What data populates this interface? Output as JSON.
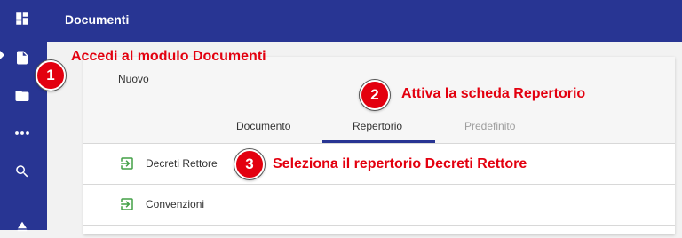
{
  "sidebar": {
    "icons": [
      "dashboard-icon",
      "document-icon",
      "folder-icon",
      "more-horizontal-icon",
      "search-icon",
      "eject-icon"
    ]
  },
  "header": {
    "title": "Documenti"
  },
  "card": {
    "new_label": "Nuovo",
    "tabs": [
      {
        "label": "Documento",
        "state": "normal"
      },
      {
        "label": "Repertorio",
        "state": "active"
      },
      {
        "label": "Predefinito",
        "state": "disabled"
      }
    ],
    "items": [
      {
        "label": "Decreti Rettore",
        "icon": "exit-to-app-icon"
      },
      {
        "label": "Convenzioni",
        "icon": "exit-to-app-icon"
      }
    ]
  },
  "annotations": [
    {
      "number": "1",
      "text": "Accedi al modulo Documenti"
    },
    {
      "number": "2",
      "text": "Attiva la scheda Repertorio"
    },
    {
      "number": "3",
      "text": "Seleziona il repertorio Decreti Rettore"
    }
  ],
  "colors": {
    "primary": "#283593",
    "annotation": "#e3000f",
    "item_icon": "#43a047"
  }
}
